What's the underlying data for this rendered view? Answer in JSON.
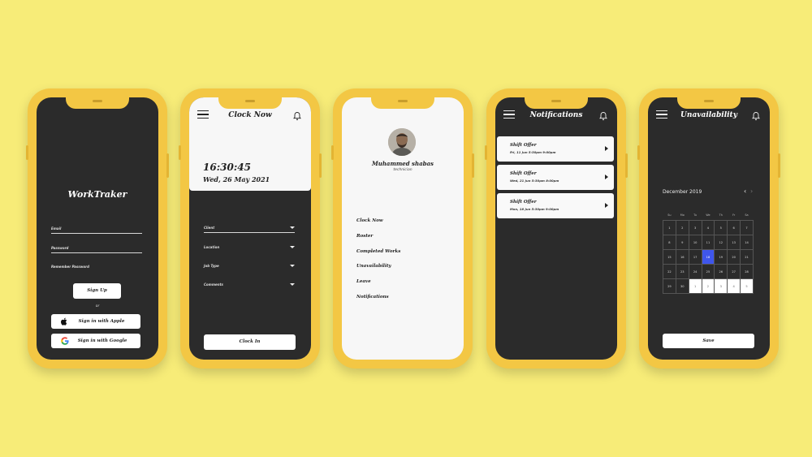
{
  "colors": {
    "background": "#f7ec78",
    "phone": "#f3c744",
    "screen_dark": "#2b2b2b",
    "selected_day": "#3f56ec"
  },
  "login": {
    "app_title": "WorkTraker",
    "email_label": "Email",
    "password_label": "Password",
    "remember_label": "Remember Password",
    "signup_label": "Sign Up",
    "or_label": "or",
    "apple_label": "Sign in with Apple",
    "google_label": "Sign in with Google"
  },
  "clock": {
    "title": "Clock Now",
    "time": "16:30:45",
    "date": "Wed, 26 May 2021",
    "fields": [
      "Client",
      "Location",
      "Job Type",
      "Comments"
    ],
    "clockin_label": "Clock In"
  },
  "menu": {
    "name": "Muhammed shabas",
    "role": "technician",
    "items": [
      "Clock Now",
      "Roster",
      "Completed Works",
      "Unavailability",
      "Leave",
      "Notifications"
    ]
  },
  "notifications": {
    "title": "Notifications",
    "items": [
      {
        "title": "Shift Offer",
        "detail": "Fri, 11 Jun 5:30pm  9:00pm"
      },
      {
        "title": "Shift Offer",
        "detail": "Wed, 21 Jun 5:30pm  8:00pm"
      },
      {
        "title": "Shift Offer",
        "detail": "Mon, 18 Jun 5:30pm  9:00pm"
      }
    ]
  },
  "unavailability": {
    "title": "Unavailability",
    "month": "December 2019",
    "weekdays": [
      "Su",
      "Mo",
      "Tu",
      "We",
      "Th",
      "Fr",
      "Sa"
    ],
    "weeks": [
      [
        "1",
        "2",
        "3",
        "4",
        "5",
        "6",
        "7"
      ],
      [
        "8",
        "9",
        "10",
        "11",
        "12",
        "13",
        "14"
      ],
      [
        "15",
        "16",
        "17",
        "18",
        "19",
        "20",
        "21"
      ],
      [
        "22",
        "23",
        "24",
        "25",
        "26",
        "27",
        "28"
      ],
      [
        "29",
        "30",
        "1",
        "2",
        "3",
        "4",
        "5"
      ]
    ],
    "selected_day": "18",
    "save_label": "Save"
  }
}
